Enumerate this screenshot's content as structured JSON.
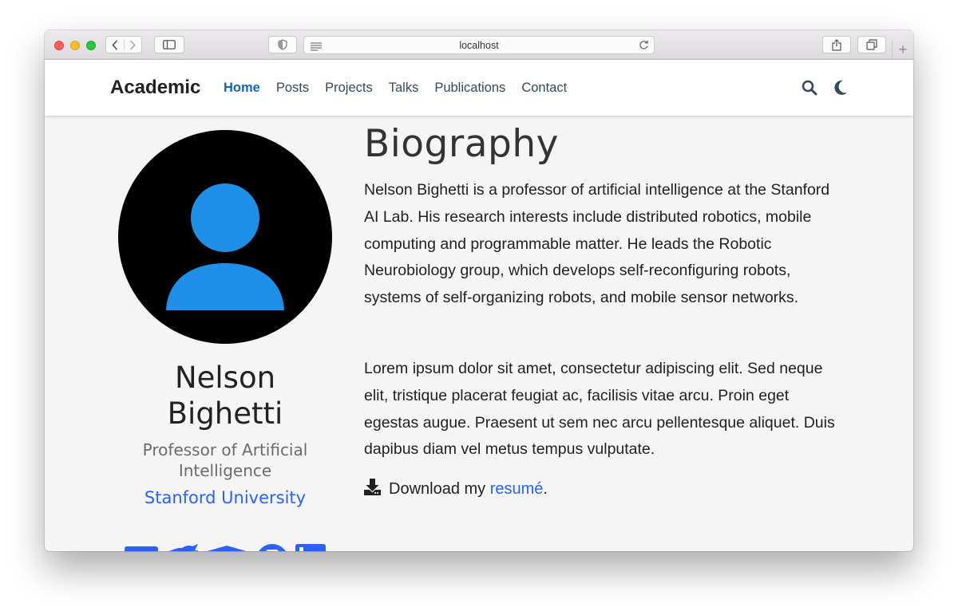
{
  "browser": {
    "url": "localhost"
  },
  "site": {
    "brand": "Academic",
    "nav": [
      {
        "label": "Home",
        "active": true
      },
      {
        "label": "Posts",
        "active": false
      },
      {
        "label": "Projects",
        "active": false
      },
      {
        "label": "Talks",
        "active": false
      },
      {
        "label": "Publications",
        "active": false
      },
      {
        "label": "Contact",
        "active": false
      }
    ],
    "icons": [
      "search-icon",
      "moon-icon"
    ],
    "accent_color": "#1565c0",
    "link_color": "#2962ff"
  },
  "profile": {
    "name_line1": "Nelson",
    "name_line2": "Bighetti",
    "role_line1": "Professor of Artificial",
    "role_line2": "Intelligence",
    "organization": "Stanford University",
    "social_icons": [
      "envelope-icon",
      "twitter-icon",
      "graduation-cap-icon",
      "github-icon",
      "linkedin-icon"
    ]
  },
  "biography": {
    "title": "Biography",
    "paragraph1": "Nelson Bighetti is a professor of artificial intelligence at the Stanford AI Lab. His research interests include distributed robotics, mobile computing and programmable matter. He leads the Robotic Neurobiology group, which develops self-reconfiguring robots, systems of self-organizing robots, and mobile sensor networks.",
    "paragraph2": "Lorem ipsum dolor sit amet, consectetur adipiscing elit. Sed neque elit, tristique placerat feugiat ac, facilisis vitae arcu. Proin eget egestas augue. Praesent ut sem nec arcu pellentesque aliquet. Duis dapibus diam vel metus tempus vulputate.",
    "download_prefix": "Download my ",
    "download_link": "resumé",
    "download_suffix": "."
  }
}
